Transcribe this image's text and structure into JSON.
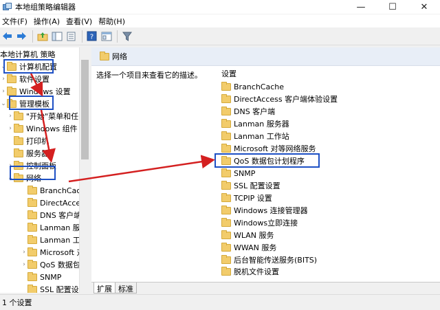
{
  "window": {
    "title": "本地组策略编辑器",
    "minimize": "—",
    "maximize": "☐",
    "close": "✕"
  },
  "menu": [
    "文件(F)",
    "操作(A)",
    "查看(V)",
    "帮助(H)"
  ],
  "tree": {
    "root_label": "本地计算机 策略",
    "items": [
      {
        "label": "计算机配置",
        "expander": "⌄"
      },
      {
        "label": "软件设置",
        "expander": "›"
      },
      {
        "label": "Windows 设置",
        "expander": "›"
      },
      {
        "label": "管理模板",
        "expander": "⌄"
      },
      {
        "label": "\"开始\"菜单和任",
        "expander": "›"
      },
      {
        "label": "Windows 组件",
        "expander": "›"
      },
      {
        "label": "打印机",
        "expander": ""
      },
      {
        "label": "服务器",
        "expander": ""
      },
      {
        "label": "控制面板",
        "expander": "›"
      },
      {
        "label": "网络",
        "expander": "⌄"
      },
      {
        "label": "BranchCach",
        "expander": ""
      },
      {
        "label": "DirectAcces",
        "expander": ""
      },
      {
        "label": "DNS 客户端",
        "expander": ""
      },
      {
        "label": "Lanman 服",
        "expander": ""
      },
      {
        "label": "Lanman 工",
        "expander": ""
      },
      {
        "label": "Microsoft 对",
        "expander": "›"
      },
      {
        "label": "QoS 数据包",
        "expander": "›"
      },
      {
        "label": "SNMP",
        "expander": ""
      },
      {
        "label": "SSL 配置设",
        "expander": ""
      }
    ]
  },
  "right": {
    "header": "网络",
    "description": "选择一个项目来查看它的描述。",
    "column_title": "设置",
    "items": [
      "BranchCache",
      "DirectAccess 客户端体验设置",
      "DNS 客户端",
      "Lanman 服务器",
      "Lanman 工作站",
      "Microsoft 对等网络服务",
      "QoS 数据包计划程序",
      "SNMP",
      "SSL 配置设置",
      "TCPIP 设置",
      "Windows 连接管理器",
      "Windows立即连接",
      "WLAN 服务",
      "WWAN 服务",
      "后台智能传送服务(BITS)",
      "脱机文件设置"
    ]
  },
  "tabs": [
    "扩展",
    "标准"
  ],
  "status": "1 个设置",
  "colors": {
    "highlight": "#1c4fc4",
    "arrow": "#d42020",
    "folder": "#f2cc6b"
  }
}
